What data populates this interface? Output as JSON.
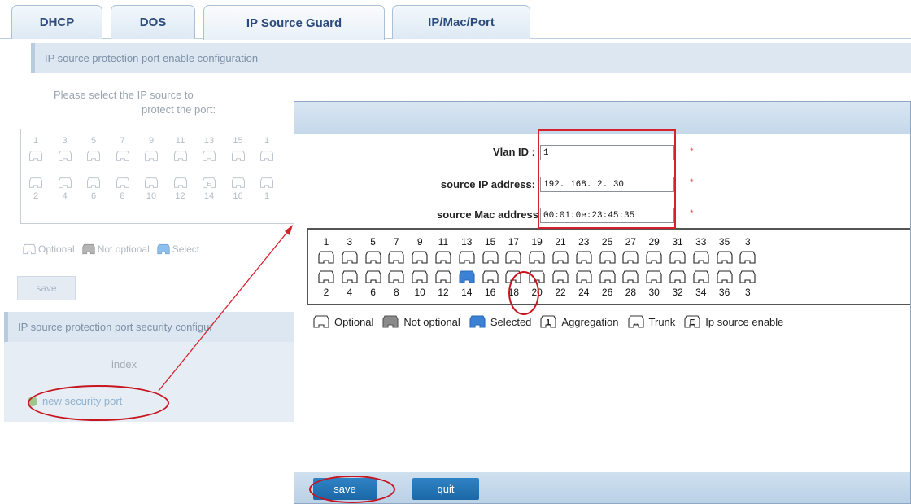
{
  "tabs": [
    "DHCP",
    "DOS",
    "IP Source Guard",
    "IP/Mac/Port"
  ],
  "background": {
    "section1_title": "IP source protection port enable configuration",
    "prompt_line1": "Please select the IP source to",
    "prompt_line2": "protect the port:",
    "top_numbers": [
      "1",
      "3",
      "5",
      "7",
      "9",
      "11",
      "13",
      "15",
      "1"
    ],
    "bottom_numbers": [
      "2",
      "4",
      "6",
      "8",
      "10",
      "12",
      "14",
      "16",
      "1"
    ],
    "legend_optional": "Optional",
    "legend_not_optional": "Not optional",
    "legend_selected": "Select",
    "save_label": "save",
    "section2_title": "IP source protection port security configur",
    "index_label": "index",
    "new_port_link": "new security port"
  },
  "dialog": {
    "vlan_label": "Vlan ID :",
    "vlan_value": "1",
    "ip_label": "source IP address:",
    "ip_value": "192. 168. 2. 30",
    "mac_label": "source Mac address",
    "mac_value": "00:01:0e:23:45:35",
    "required_mark": "*",
    "top_ports": [
      "1",
      "3",
      "5",
      "7",
      "9",
      "11",
      "13",
      "15",
      "17",
      "19",
      "21",
      "23",
      "25",
      "27",
      "29",
      "31",
      "33",
      "35",
      "3"
    ],
    "bottom_ports": [
      "2",
      "4",
      "6",
      "8",
      "10",
      "12",
      "14",
      "16",
      "18",
      "20",
      "22",
      "24",
      "26",
      "28",
      "30",
      "32",
      "34",
      "36",
      "3"
    ],
    "selected_port": "14",
    "legend": {
      "optional": "Optional",
      "not_optional": "Not optional",
      "selected": "Selected",
      "aggregation": "Aggregation",
      "aggregation_glyph": "1",
      "trunk": "Trunk",
      "trunk_glyph": "..",
      "ipsource": "Ip source enable",
      "ipsource_glyph": "E"
    },
    "save_label": "save",
    "quit_label": "quit"
  },
  "colors": {
    "selected_port": "#3b82d6",
    "annotation_red": "#d6202c",
    "dialog_button": "#1f6fb0"
  }
}
